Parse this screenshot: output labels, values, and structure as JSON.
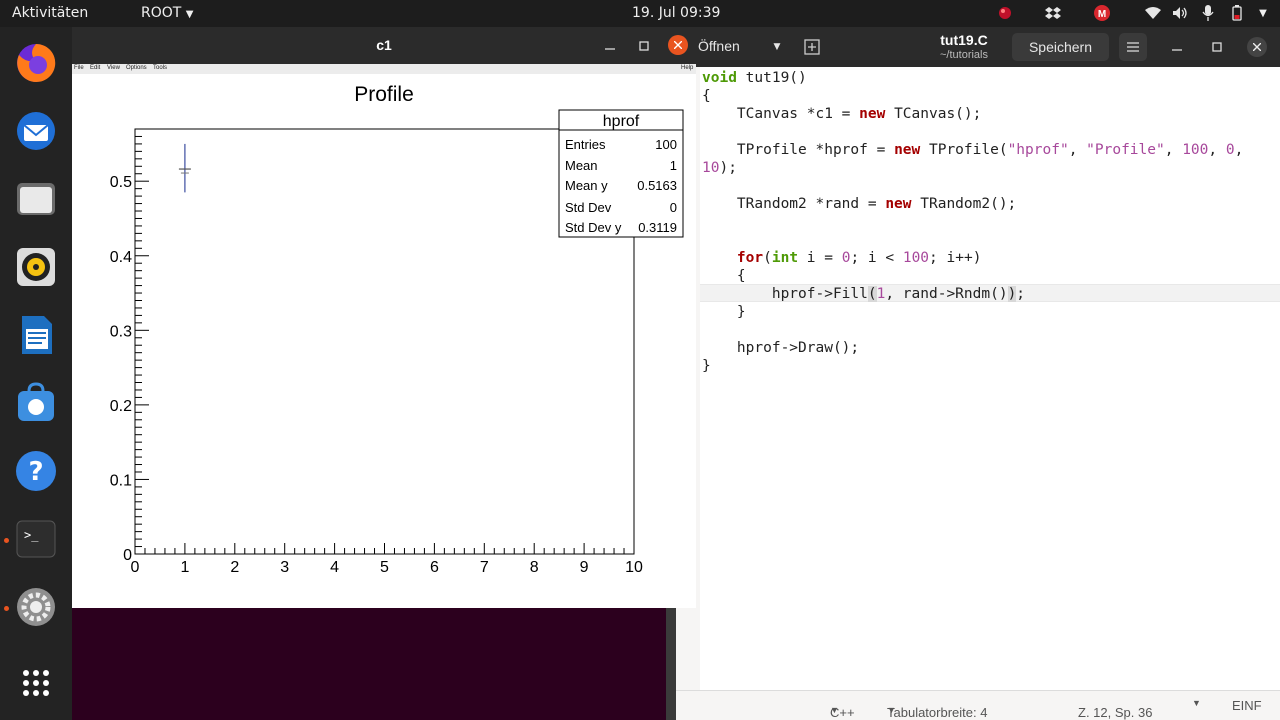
{
  "topbar": {
    "activities": "Aktivitäten",
    "app_menu": "ROOT",
    "datetime": "19. Jul  09:39"
  },
  "c1_window": {
    "title": "c1",
    "menu": [
      "File",
      "Edit",
      "View",
      "Options",
      "Tools"
    ],
    "help": "Help"
  },
  "stats_box": {
    "title": "hprof",
    "rows": [
      {
        "label": "Entries",
        "value": "100"
      },
      {
        "label": "Mean",
        "value": "1"
      },
      {
        "label": "Mean y",
        "value": "0.5163"
      },
      {
        "label": "Std Dev",
        "value": "0"
      },
      {
        "label": "Std Dev y",
        "value": "0.3119"
      }
    ]
  },
  "chart_data": {
    "type": "scatter",
    "title": "Profile",
    "xlabel": "",
    "ylabel": "",
    "xlim": [
      0,
      10
    ],
    "ylim": [
      0,
      0.57
    ],
    "x_ticks": [
      "0",
      "1",
      "2",
      "3",
      "4",
      "5",
      "6",
      "7",
      "8",
      "9",
      "10"
    ],
    "y_ticks": [
      "0",
      "0.1",
      "0.2",
      "0.3",
      "0.4",
      "0.5"
    ],
    "points": [
      {
        "x": 1,
        "y": 0.5163,
        "err_low": 0.485,
        "err_high": 0.55
      }
    ],
    "marker_color": "#3b4da0"
  },
  "editor": {
    "open_label": "Öffnen",
    "file_name": "tut19.C",
    "file_path": "~/tutorials",
    "save_label": "Speichern",
    "status": {
      "language": "C++",
      "tab_width": "Tabulatorbreite: 4",
      "position": "Z. 12, Sp. 36",
      "mode": "EINF"
    }
  },
  "colors": {
    "keyword": "#a40000",
    "type": "#4e9a06",
    "string": "#a7489b",
    "accent": "#e95420"
  }
}
